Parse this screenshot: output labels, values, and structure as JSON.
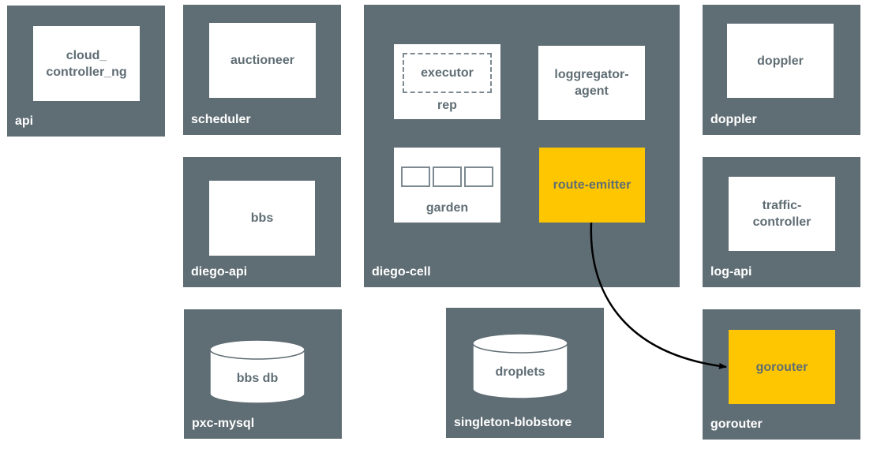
{
  "diagram": {
    "colors": {
      "vm": "#5f6d74",
      "job": "#ffffff",
      "highlight": "#fdc600",
      "text": "#5f6d74",
      "arrow": "#000000"
    },
    "vms": {
      "api": {
        "label": "api",
        "jobs": [
          "cloud_\ncontroller_ng"
        ]
      },
      "scheduler": {
        "label": "scheduler",
        "jobs": [
          "auctioneer"
        ]
      },
      "diego_api": {
        "label": "diego-api",
        "jobs": [
          "bbs"
        ]
      },
      "diego_cell": {
        "label": "diego-cell",
        "rep": {
          "label": "rep",
          "inner": "executor"
        },
        "loggregator_agent": "loggregator-\nagent",
        "garden": {
          "label": "garden",
          "containers": 3
        },
        "route_emitter": "route-emitter"
      },
      "doppler": {
        "label": "doppler",
        "jobs": [
          "doppler"
        ]
      },
      "log_api": {
        "label": "log-api",
        "jobs": [
          "traffic-\ncontroller"
        ]
      },
      "pxc_mysql": {
        "label": "pxc-mysql",
        "database": "bbs db"
      },
      "singleton_blobstore": {
        "label": "singleton-blobstore",
        "database": "droplets"
      },
      "gorouter": {
        "label": "gorouter",
        "jobs": [
          "gorouter"
        ]
      }
    },
    "edges": [
      {
        "from": "route-emitter",
        "to": "gorouter"
      }
    ]
  }
}
